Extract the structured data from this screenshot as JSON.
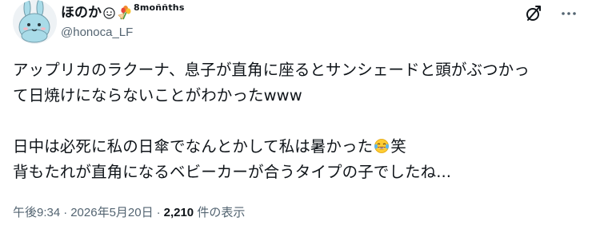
{
  "author": {
    "display_name": "ほのか",
    "name_suffix": "8moññths",
    "handle": "@honoca_LF"
  },
  "tweet": {
    "line1": "アップリカのラクーナ、息子が直角に座るとサンシェードと頭がぶつかっ",
    "line2": "て日焼けにならないことがわかったwww",
    "line3_before_emoji": "日中は必死に私の日傘でなんとかして私は暑かった",
    "line3_after_emoji": "笑",
    "line4": "背もたれが直角になるベビーカーが合うタイプの子でしたね..."
  },
  "meta": {
    "time": "午後9:34",
    "separator": "·",
    "date": "2026年5月20日",
    "views_count": "2,210",
    "views_label": "件の表示"
  },
  "icons": {
    "avatar": "bunny-character-avatar",
    "smile": "smiling-face-emoji",
    "flower": "tulip-bouquet-emoji",
    "grok": "grok-icon",
    "more": "more-dots-icon",
    "laugh": "face-with-tears-of-joy-emoji"
  }
}
